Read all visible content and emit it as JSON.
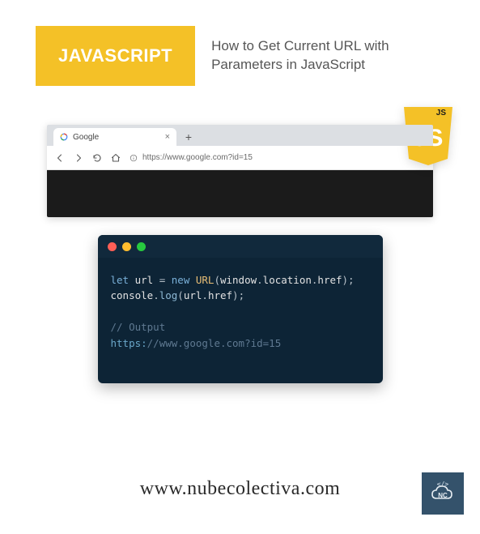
{
  "header": {
    "badge": "JAVASCRIPT",
    "title": "How to Get Current URL with Parameters in JavaScript"
  },
  "logo": {
    "top_text": "JS",
    "main_text": "JS"
  },
  "browser": {
    "tab_title": "Google",
    "tab_close": "×",
    "tab_new": "+",
    "url_display": "https://www.google.com?id=15"
  },
  "code": {
    "line1": {
      "kw": "let",
      "var": "url",
      "eq": " = ",
      "new": "new",
      "cls": "URL",
      "args_a": "window",
      "dot1": ".",
      "args_b": "location",
      "dot2": ".",
      "args_c": "href",
      "close": ");"
    },
    "line2": {
      "obj": "console",
      "dot": ".",
      "method": "log",
      "open": "(",
      "v": "url",
      "dot2": ".",
      "prop": "href",
      "close": ");"
    },
    "comment": "// Output",
    "output": {
      "proto": "https:",
      "rest": "//www.google.com?id=15"
    }
  },
  "footer": {
    "url": "www.nubecolectiva.com",
    "badge_text": "NC"
  }
}
